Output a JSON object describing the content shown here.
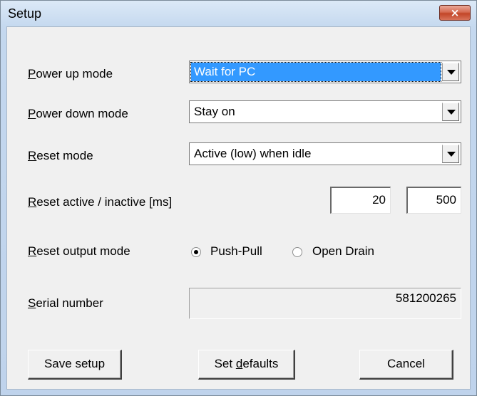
{
  "window": {
    "title": "Setup",
    "close_label": "×"
  },
  "power_up": {
    "label_key": "P",
    "label_rest": "ower up mode",
    "value": "Wait for PC"
  },
  "power_down": {
    "label_key": "P",
    "label_rest": "ower down mode",
    "value": "Stay on"
  },
  "reset_mode": {
    "label_key": "R",
    "label_rest": "eset mode",
    "value": "Active (low) when idle"
  },
  "reset_timing": {
    "label_key": "R",
    "label_rest": "eset active / inactive [ms]",
    "active_value": "20",
    "inactive_value": "500"
  },
  "reset_output": {
    "label_key": "R",
    "label_rest": "eset output mode",
    "options": [
      {
        "label": "Push-Pull",
        "checked": true
      },
      {
        "label": "Open Drain",
        "checked": false
      }
    ]
  },
  "serial": {
    "label_key": "S",
    "label_rest": "erial number",
    "value": "581200265"
  },
  "buttons": {
    "save_label": "Save setup",
    "defaults_pre": "Set ",
    "defaults_key": "d",
    "defaults_rest": "efaults",
    "cancel_label": "Cancel"
  }
}
